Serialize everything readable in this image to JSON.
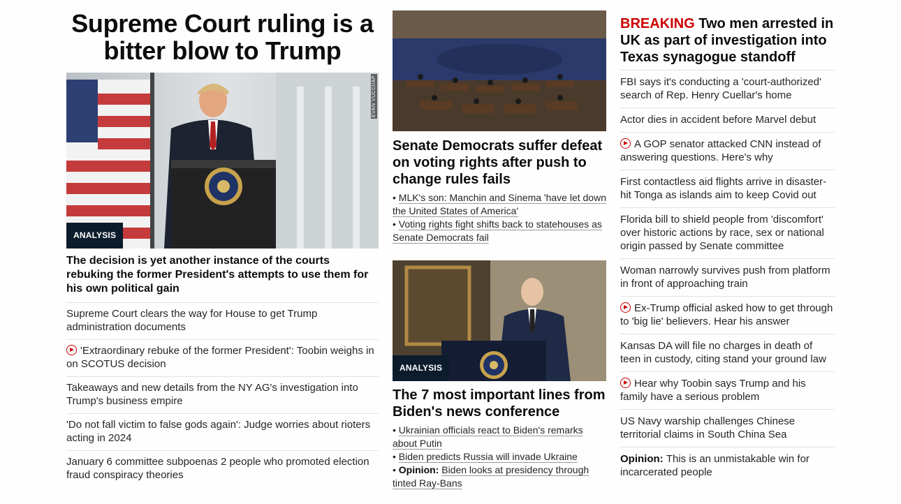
{
  "left": {
    "headline": "Supreme Court ruling is a bitter blow to Trump",
    "image_credit": "EVAN VUCCI/AP",
    "badge": "ANALYSIS",
    "deck": "The decision is yet another instance of the courts rebuking the former President's attempts to use them for his own political gain",
    "items": [
      {
        "text": "Supreme Court clears the way for House to get Trump administration documents",
        "video": false
      },
      {
        "text": "'Extraordinary rebuke of the former President': Toobin weighs in on SCOTUS decision",
        "video": true
      },
      {
        "text": "Takeaways and new details from the NY AG's investigation into Trump's business empire",
        "video": false
      },
      {
        "text": "'Do not fall victim to false gods again': Judge worries about rioters acting in 2024",
        "video": false
      },
      {
        "text": "January 6 committee subpoenas 2 people who promoted election fraud conspiracy theories",
        "video": false
      }
    ]
  },
  "middle": {
    "story1": {
      "title": "Senate Democrats suffer defeat on voting rights after push to change rules fails",
      "bullets": [
        "MLK's son: Manchin and Sinema 'have let down the United States of America'",
        "Voting rights fight shifts back to statehouses as Senate Democrats fail"
      ]
    },
    "story2": {
      "badge": "ANALYSIS",
      "title": "The 7 most important lines from Biden's news conference",
      "bullets": [
        {
          "prefix": "",
          "text": "Ukrainian officials react to Biden's remarks about Putin"
        },
        {
          "prefix": "",
          "text": "Biden predicts Russia will invade Ukraine"
        },
        {
          "prefix": "Opinion:",
          "text": "Biden looks at presidency through tinted Ray-Bans"
        }
      ],
      "bullet_char": "•"
    }
  },
  "right": {
    "breaking_tag": "BREAKING",
    "breaking_title": "Two men arrested in UK as part of investigation into Texas synagogue standoff",
    "items": [
      {
        "text": "FBI says it's conducting a 'court-authorized' search of Rep. Henry Cuellar's home",
        "video": false,
        "prefix": ""
      },
      {
        "text": "Actor dies in accident before Marvel debut",
        "video": false,
        "prefix": ""
      },
      {
        "text": "A GOP senator attacked CNN instead of answering questions. Here's why",
        "video": true,
        "prefix": ""
      },
      {
        "text": "First contactless aid flights arrive in disaster-hit Tonga as islands aim to keep Covid out",
        "video": false,
        "prefix": ""
      },
      {
        "text": "Florida bill to shield people from 'discomfort' over historic actions by race, sex or national origin passed by Senate committee",
        "video": false,
        "prefix": ""
      },
      {
        "text": "Woman narrowly survives push from platform in front of approaching train",
        "video": false,
        "prefix": ""
      },
      {
        "text": "Ex-Trump official asked how to get through to 'big lie' believers. Hear his answer",
        "video": true,
        "prefix": ""
      },
      {
        "text": "Kansas DA will file no charges in death of teen in custody, citing stand your ground law",
        "video": false,
        "prefix": ""
      },
      {
        "text": "Hear why Toobin says Trump and his family have a serious problem",
        "video": true,
        "prefix": ""
      },
      {
        "text": "US Navy warship challenges Chinese territorial claims in South China Sea",
        "video": false,
        "prefix": ""
      },
      {
        "text": "This is an unmistakable win for incarcerated people",
        "video": false,
        "prefix": "Opinion:"
      }
    ]
  },
  "colors": {
    "breaking": "#cc0000",
    "badge_bg": "#0c1c2c",
    "play_icon": "#cc0000",
    "divider": "#e2e2e2"
  }
}
